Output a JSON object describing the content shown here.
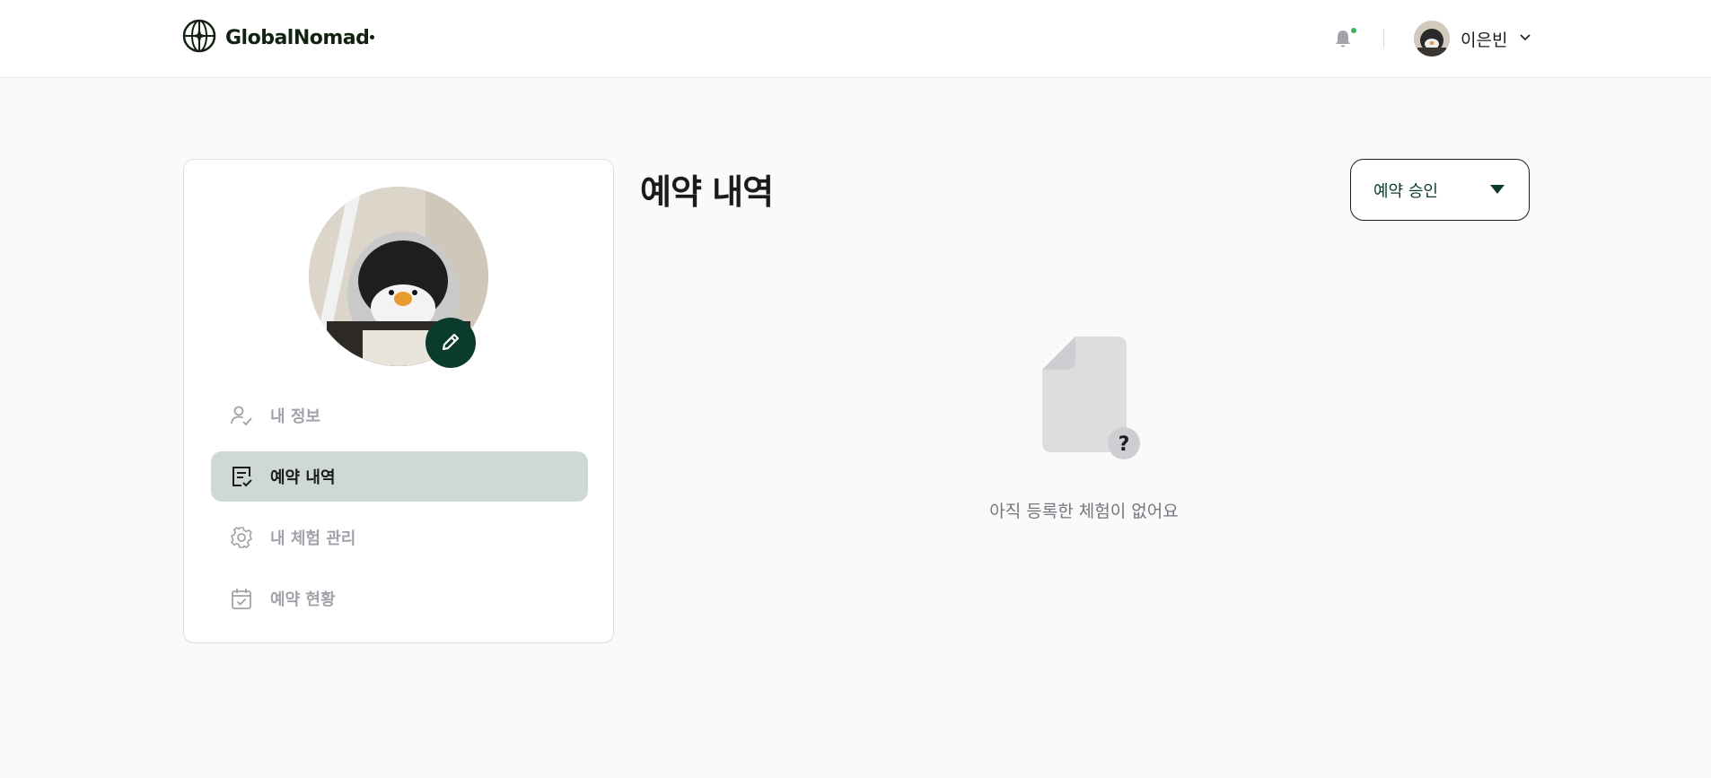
{
  "header": {
    "logo_text": "GlobalNomad",
    "user_name": "이은빈",
    "notification_dot_color": "#3ab25a"
  },
  "sidebar": {
    "items": [
      {
        "label": "내 정보",
        "icon": "user-check-icon",
        "active": false
      },
      {
        "label": "예약 내역",
        "icon": "checklist-icon",
        "active": true
      },
      {
        "label": "내 체험 관리",
        "icon": "gear-icon",
        "active": false
      },
      {
        "label": "예약 현황",
        "icon": "calendar-check-icon",
        "active": false
      }
    ]
  },
  "main": {
    "title": "예약 내역",
    "filter": {
      "selected": "예약 승인"
    },
    "empty_state": {
      "message": "아직 등록한 체험이 없어요",
      "icon": "document-question-icon"
    }
  },
  "colors": {
    "brand": "#0b3b2d",
    "active_bg": "#ced8d5",
    "inactive_text": "#a4a1aa",
    "background": "#fafafa"
  }
}
